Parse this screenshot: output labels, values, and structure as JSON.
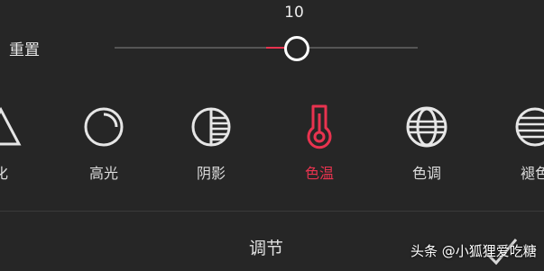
{
  "slider": {
    "value": "10",
    "fraction": 0.6
  },
  "reset_label": "重置",
  "tools": [
    {
      "id": "sharpen",
      "label": "化",
      "icon": "triangle-icon",
      "active": false
    },
    {
      "id": "highlight",
      "label": "高光",
      "icon": "highlight-circle-icon",
      "active": false
    },
    {
      "id": "shadow",
      "label": "阴影",
      "icon": "shadow-half-circle-icon",
      "active": false
    },
    {
      "id": "temperature",
      "label": "色温",
      "icon": "thermometer-icon",
      "active": true
    },
    {
      "id": "tint",
      "label": "色调",
      "icon": "tint-circle-icon",
      "active": false
    },
    {
      "id": "fade",
      "label": "褪色",
      "icon": "fade-circle-icon",
      "active": false
    }
  ],
  "footer": {
    "title": "调节"
  },
  "watermark": "头条 @小狐狸爱吃糖",
  "colors": {
    "accent": "#e8334f",
    "background": "#262626",
    "icon": "#e6e6e6"
  }
}
